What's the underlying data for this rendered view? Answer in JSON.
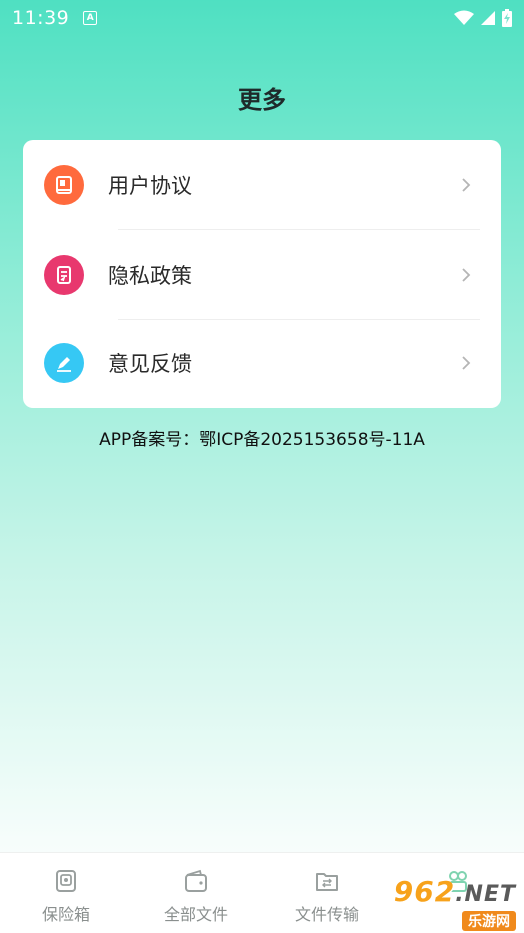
{
  "status_bar": {
    "time": "11:39",
    "notification_icon": "A"
  },
  "header": {
    "title": "更多"
  },
  "menu": {
    "items": [
      {
        "label": "用户协议",
        "icon": "book-icon",
        "color": "#ff6a3d"
      },
      {
        "label": "隐私政策",
        "icon": "document-icon",
        "color": "#e8386e"
      },
      {
        "label": "意见反馈",
        "icon": "pencil-icon",
        "color": "#36c8f4"
      }
    ]
  },
  "record": {
    "text": "APP备案号：鄂ICP备2025153658号-11A"
  },
  "tabs": [
    {
      "label": "保险箱",
      "icon": "safe-icon"
    },
    {
      "label": "全部文件",
      "icon": "wallet-folder-icon"
    },
    {
      "label": "文件传输",
      "icon": "transfer-folder-icon"
    },
    {
      "label": "",
      "icon": "more-icon"
    }
  ],
  "watermark": {
    "brand": "962",
    "suffix": ".NET",
    "site": "乐游网"
  }
}
